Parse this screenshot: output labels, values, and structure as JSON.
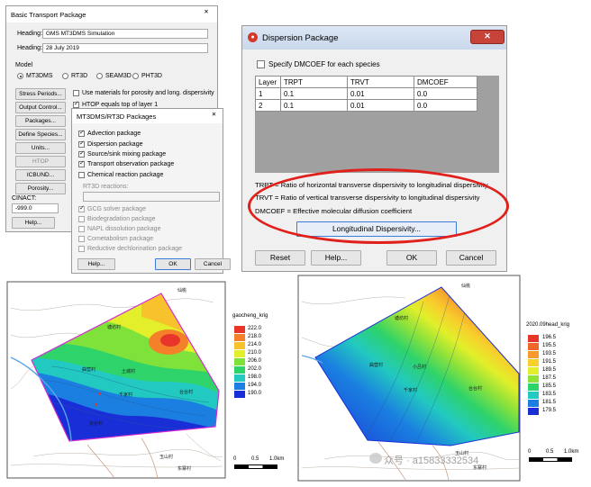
{
  "btp": {
    "title": "Basic Transport Package",
    "heading1_label": "Heading:",
    "heading1_value": "GMS MT3DMS Simulation",
    "heading2_label": "Heading:",
    "heading2_value": "28 July 2019",
    "model_label": "Model",
    "models": [
      "MT3DMS",
      "RT3D",
      "SEAM3D",
      "PHT3D"
    ],
    "selected_model": "MT3DMS",
    "buttons": [
      "Stress Periods...",
      "Output Control...",
      "Packages...",
      "Define Species...",
      "Units...",
      "HTOP",
      "ICBUND...",
      "Porosity..."
    ],
    "opt1": "Use materials for porosity and long. dispersivity",
    "opt2": "HTOP equals top of layer 1",
    "cinact_label": "CINACT:",
    "cinact_value": "-999.0",
    "help": "Help..."
  },
  "pkg": {
    "title": "MT3DMS/RT3D Packages",
    "items": [
      {
        "label": "Advection package",
        "checked": true,
        "enabled": true
      },
      {
        "label": "Dispersion package",
        "checked": true,
        "enabled": true
      },
      {
        "label": "Source/sink mixing package",
        "checked": true,
        "enabled": true
      },
      {
        "label": "Transport observation package",
        "checked": true,
        "enabled": true
      },
      {
        "label": "Chemical reaction package",
        "checked": false,
        "enabled": true
      }
    ],
    "rt3d_label": "RT3D reactions:",
    "items2": [
      {
        "label": "GCG solver package",
        "checked": true,
        "enabled": false
      },
      {
        "label": "Biodegradation package",
        "checked": false,
        "enabled": false
      },
      {
        "label": "NAPL dissolution package",
        "checked": false,
        "enabled": false
      },
      {
        "label": "Cometabolism package",
        "checked": false,
        "enabled": false
      },
      {
        "label": "Reductive dechlorination package",
        "checked": false,
        "enabled": false
      }
    ],
    "help": "Help...",
    "ok": "OK",
    "cancel": "Cancel"
  },
  "disp": {
    "title": "Dispersion Package",
    "specify": "Specify DMCOEF for each species",
    "headers": [
      "Layer",
      "TRPT",
      "TRVT",
      "DMCOEF"
    ],
    "rows": [
      [
        "1",
        "0.1",
        "0.01",
        "0.0"
      ],
      [
        "2",
        "0.1",
        "0.01",
        "0.0"
      ]
    ],
    "desc1": "TRPT = Ratio of horizontal transverse dispersivity to longitudinal dispersivity",
    "desc2": "TRVT = Ratio of vertical transverse dispersivity to longitudinal dispersivity",
    "desc3": "DMCOEF = Effective molecular diffusion coefficient",
    "long_btn": "Longitudinal Dispersivity...",
    "reset": "Reset",
    "help": "Help...",
    "ok": "OK",
    "cancel": "Cancel",
    "annotation_color": "#e0201b"
  },
  "map1": {
    "legend_title": "gaocheng_krig",
    "levels": [
      "222.0",
      "218.0",
      "214.0",
      "210.0",
      "206.0",
      "202.0",
      "198.0",
      "194.0",
      "190.0"
    ],
    "colors": [
      "#e8352a",
      "#f4802a",
      "#f8c22c",
      "#e2ef2a",
      "#7ee23a",
      "#2ed36a",
      "#22c9c0",
      "#1a7fe0",
      "#1a2ed8"
    ],
    "scale": [
      "0",
      "0.5",
      "1.0km"
    ]
  },
  "map2": {
    "legend_title": "2020.09head_krig",
    "levels": [
      "196.5",
      "195.5",
      "193.5",
      "191.5",
      "189.5",
      "187.5",
      "185.5",
      "183.5",
      "181.5",
      "179.5"
    ],
    "colors": [
      "#e8352a",
      "#f2662a",
      "#f69a2c",
      "#f8cf2c",
      "#e2ef2a",
      "#8ee23a",
      "#2ed36a",
      "#22c9c0",
      "#1a7fe0",
      "#1a2ed8"
    ],
    "scale": [
      "0",
      "0.5",
      "1.0km"
    ],
    "watermark": "众号 · a15833332534"
  }
}
